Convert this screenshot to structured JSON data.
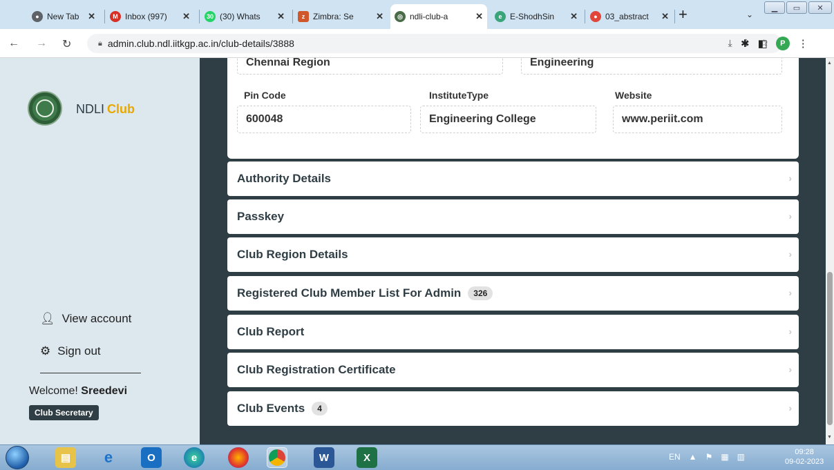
{
  "browser": {
    "tabs": [
      {
        "label": "New Tab",
        "icon": "chrome-icon",
        "color": "#5f6368"
      },
      {
        "label": "Inbox (997)",
        "icon": "gmail-icon",
        "color": "#d93025"
      },
      {
        "label": "(30) Whats",
        "icon": "whatsapp-icon",
        "color": "#25d366",
        "badge": "30"
      },
      {
        "label": "Zimbra: Se",
        "icon": "zimbra-icon",
        "color": "#d0572a"
      },
      {
        "label": "ndli-club-a",
        "icon": "ndli-icon",
        "color": "#4a6b48"
      },
      {
        "label": "E-ShodhSin",
        "icon": "eshodh-icon",
        "color": "#3aa57a"
      },
      {
        "label": "03_abstract",
        "icon": "doc-icon",
        "color": "#e0473a"
      }
    ],
    "active_tab": 4,
    "url": "admin.club.ndl.iitkgp.ac.in/club-details/3888",
    "profile_initial": "P"
  },
  "sidebar": {
    "brand_prefix": "NDLI",
    "brand_accent": "Club",
    "view_account": "View account",
    "sign_out": "Sign out",
    "welcome_prefix": "Welcome!",
    "user_name": "Sreedevi",
    "role": "Club Secretary"
  },
  "details": {
    "top_row": [
      "Chennai Region",
      "Engineering"
    ],
    "fields": [
      {
        "label": "Pin Code",
        "value": "600048"
      },
      {
        "label": "InstituteType",
        "value": "Engineering College"
      },
      {
        "label": "Website",
        "value": "www.periit.com"
      }
    ]
  },
  "sections": [
    {
      "label": "Authority Details"
    },
    {
      "label": "Passkey"
    },
    {
      "label": "Club Region Details"
    },
    {
      "label": "Registered Club Member List For Admin",
      "count": "326"
    },
    {
      "label": "Club Report"
    },
    {
      "label": "Club Registration Certificate"
    },
    {
      "label": "Club Events",
      "count": "4"
    }
  ],
  "taskbar": {
    "apps": [
      "explorer-icon",
      "ie-icon",
      "outlook-icon",
      "edge-icon",
      "firefox-icon",
      "chrome-icon",
      "word-icon",
      "excel-icon"
    ],
    "language": "EN",
    "time": "09:28",
    "date": "09-02-2023"
  },
  "colors": {
    "sidebar_bg": "#dce7ee",
    "page_bg": "#2f3d44",
    "accent": "#e9a800"
  }
}
